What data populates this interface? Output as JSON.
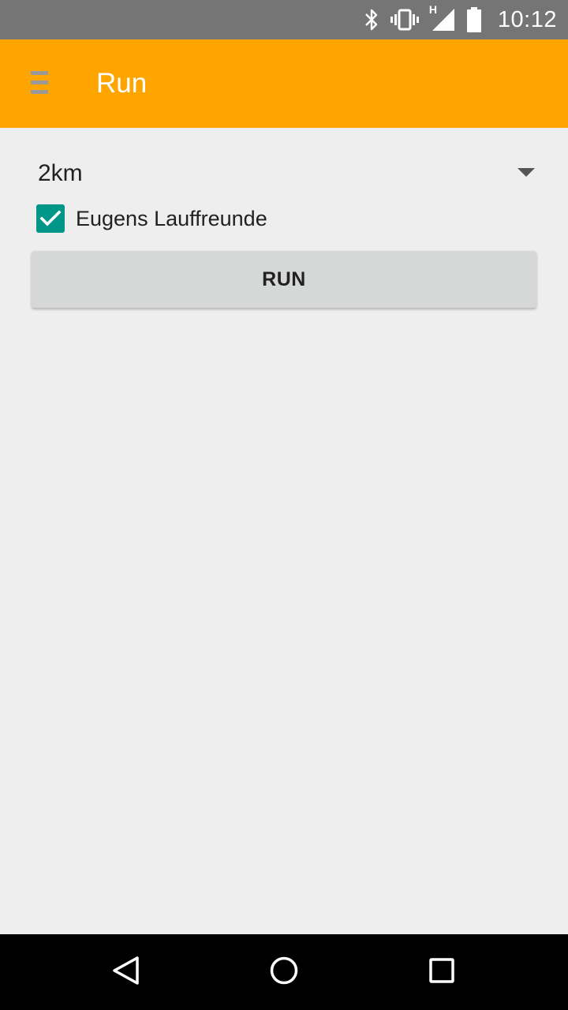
{
  "status_bar": {
    "time": "10:12",
    "network_type": "H",
    "icons": [
      "bluetooth-icon",
      "vibrate-icon",
      "signal-icon",
      "battery-icon"
    ]
  },
  "app_bar": {
    "title": "Run",
    "menu_icon": "hamburger-menu-icon",
    "background_color": "#ffa500"
  },
  "form": {
    "distance_selected": "2km",
    "dropdown_icon": "dropdown-arrow-icon",
    "group_checkbox": {
      "label": "Eugens Lauffreunde",
      "checked": true,
      "color": "#009688"
    },
    "run_button_label": "RUN"
  },
  "nav_bar": {
    "icons": [
      "back-icon",
      "home-icon",
      "recents-icon"
    ]
  }
}
